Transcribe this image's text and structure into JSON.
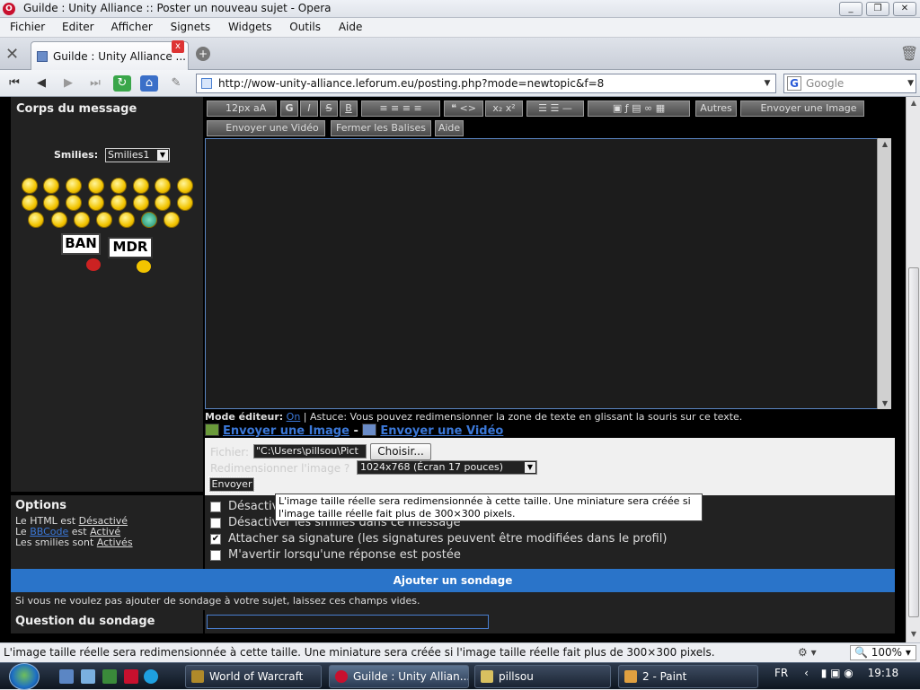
{
  "window": {
    "title": "Guilde : Unity Alliance :: Poster un nouveau sujet - Opera"
  },
  "menu": [
    "Fichier",
    "Editer",
    "Afficher",
    "Signets",
    "Widgets",
    "Outils",
    "Aide"
  ],
  "tab": {
    "label": "Guilde : Unity Alliance ..."
  },
  "address": {
    "url": "http://wow-unity-alliance.leforum.eu/posting.php?mode=newtopic&f=8",
    "search_placeholder": "Google"
  },
  "post": {
    "corps_label": "Corps du message",
    "smilies_label": "Smilies:",
    "smilies_select": "Smilies1",
    "sign_ban": "BAN",
    "sign_mdr": "MDR",
    "toolbar": {
      "font_size": "12px",
      "bold": "G",
      "italic": "I",
      "strike": "S",
      "underline": "B",
      "autres": "Autres",
      "envoyer_image": "Envoyer une Image",
      "envoyer_video": "Envoyer une Vidéo",
      "fermer_balises": "Fermer les Balises",
      "aide": "Aide"
    },
    "mode_editeur_label": "Mode éditeur:",
    "mode_editeur_value": "On",
    "astuce": "| Astuce: Vous pouvez redimensionner la zone de texte en glissant la souris sur ce texte.",
    "link_image": "Envoyer une Image",
    "link_sep": "-",
    "link_video": "Envoyer une Vidéo"
  },
  "upload": {
    "fichier_label": "Fichier:",
    "fichier_value": "\"C:\\Users\\pillsou\\Pict",
    "choisir": "Choisir...",
    "resize_label": "Redimensionner l'image ?",
    "resize_value": "1024x768 (Écran 17 pouces)",
    "envoyer": "Envoyer",
    "tooltip": "L'image taille réelle sera redimensionnée à cette taille. Une miniature sera créée si l'image taille réelle fait plus de 300×300 pixels."
  },
  "options": {
    "title": "Options",
    "html_prefix": "Le HTML est",
    "html_value": "Désactivé",
    "le": "Le",
    "bbcode": "BBCode",
    "bbcode_suffix": "est",
    "bbcode_value": "Activé",
    "smilies_prefix": "Les smilies sont",
    "smilies_value": "Activés",
    "checks": [
      {
        "label": "Désactiver",
        "checked": false
      },
      {
        "label": "Désactiver les smilies dans ce message",
        "checked": false
      },
      {
        "label": "Attacher sa signature (les signatures peuvent être modifiées dans le profil)",
        "checked": true
      },
      {
        "label": "M'avertir lorsqu'une réponse est postée",
        "checked": false
      }
    ]
  },
  "poll": {
    "header": "Ajouter un sondage",
    "info": "Si vous ne voulez pas ajouter de sondage à votre sujet, laissez ces champs vides.",
    "question_label": "Question du sondage"
  },
  "status": {
    "text": "L'image taille réelle sera redimensionnée à cette taille. Une miniature sera créée si l'image taille réelle fait plus de 300×300 pixels.",
    "zoom": "100%"
  },
  "taskbar": {
    "tasks": [
      "World of Warcraft",
      "Guilde : Unity Allian...",
      "pillsou",
      "2 - Paint"
    ],
    "lang": "FR",
    "clock": "19:18"
  }
}
